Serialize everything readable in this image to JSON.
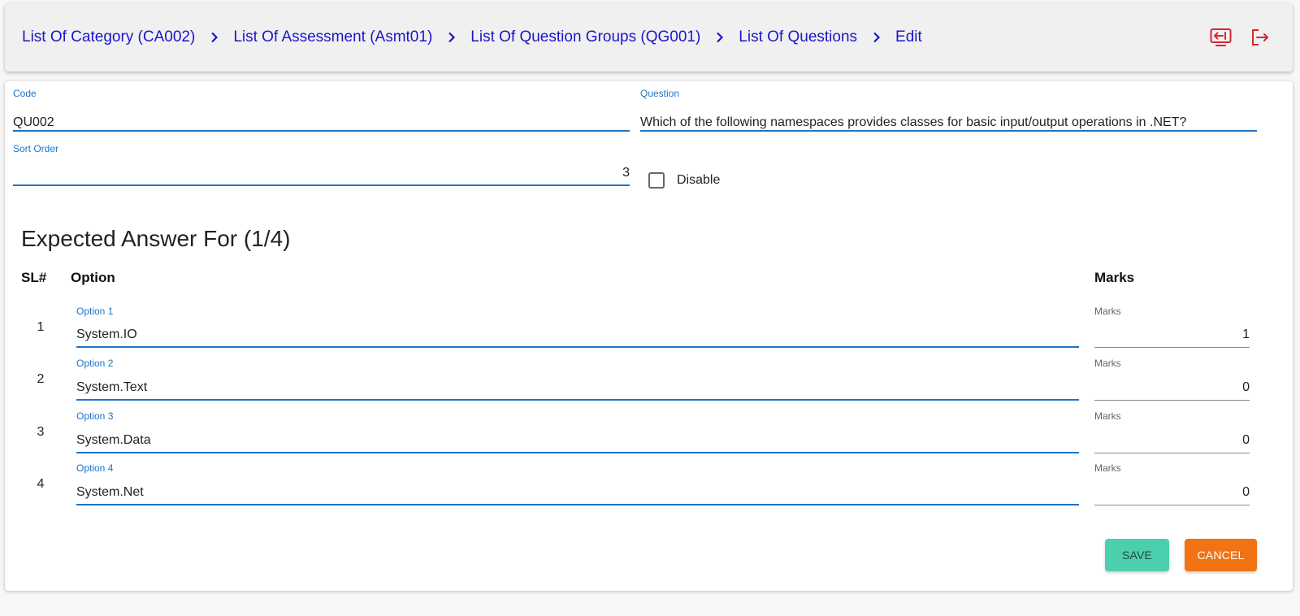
{
  "breadcrumb": {
    "items": [
      "List Of Category (CA002)",
      "List Of Assessment (Asmt01)",
      "List Of Question Groups (QG001)",
      "List Of Questions",
      "Edit"
    ]
  },
  "header_icons": [
    "switch-screen-icon",
    "logout-icon"
  ],
  "form": {
    "code": {
      "label": "Code",
      "value": "QU002"
    },
    "question": {
      "label": "Question",
      "value": "Which of the following namespaces provides classes for basic input/output operations in .NET?"
    },
    "sort_order": {
      "label": "Sort Order",
      "value": "3"
    },
    "disable": {
      "label": "Disable",
      "checked": false
    }
  },
  "answers": {
    "title": "Expected Answer For (1/4)",
    "columns": {
      "sl": "SL#",
      "option": "Option",
      "marks": "Marks"
    },
    "rows": [
      {
        "sl": "1",
        "option_label": "Option 1",
        "option_value": "System.IO",
        "marks_label": "Marks",
        "marks_value": "1"
      },
      {
        "sl": "2",
        "option_label": "Option 2",
        "option_value": "System.Text",
        "marks_label": "Marks",
        "marks_value": "0"
      },
      {
        "sl": "3",
        "option_label": "Option 3",
        "option_value": "System.Data",
        "marks_label": "Marks",
        "marks_value": "0"
      },
      {
        "sl": "4",
        "option_label": "Option 4",
        "option_value": "System.Net",
        "marks_label": "Marks",
        "marks_value": "0"
      }
    ]
  },
  "actions": {
    "save": "SAVE",
    "cancel": "CANCEL"
  },
  "colors": {
    "link": "#1a17c7",
    "field_accent": "#1e73c8",
    "icon_red": "#d9262c",
    "save": "#4ccfae",
    "cancel": "#f27314"
  }
}
